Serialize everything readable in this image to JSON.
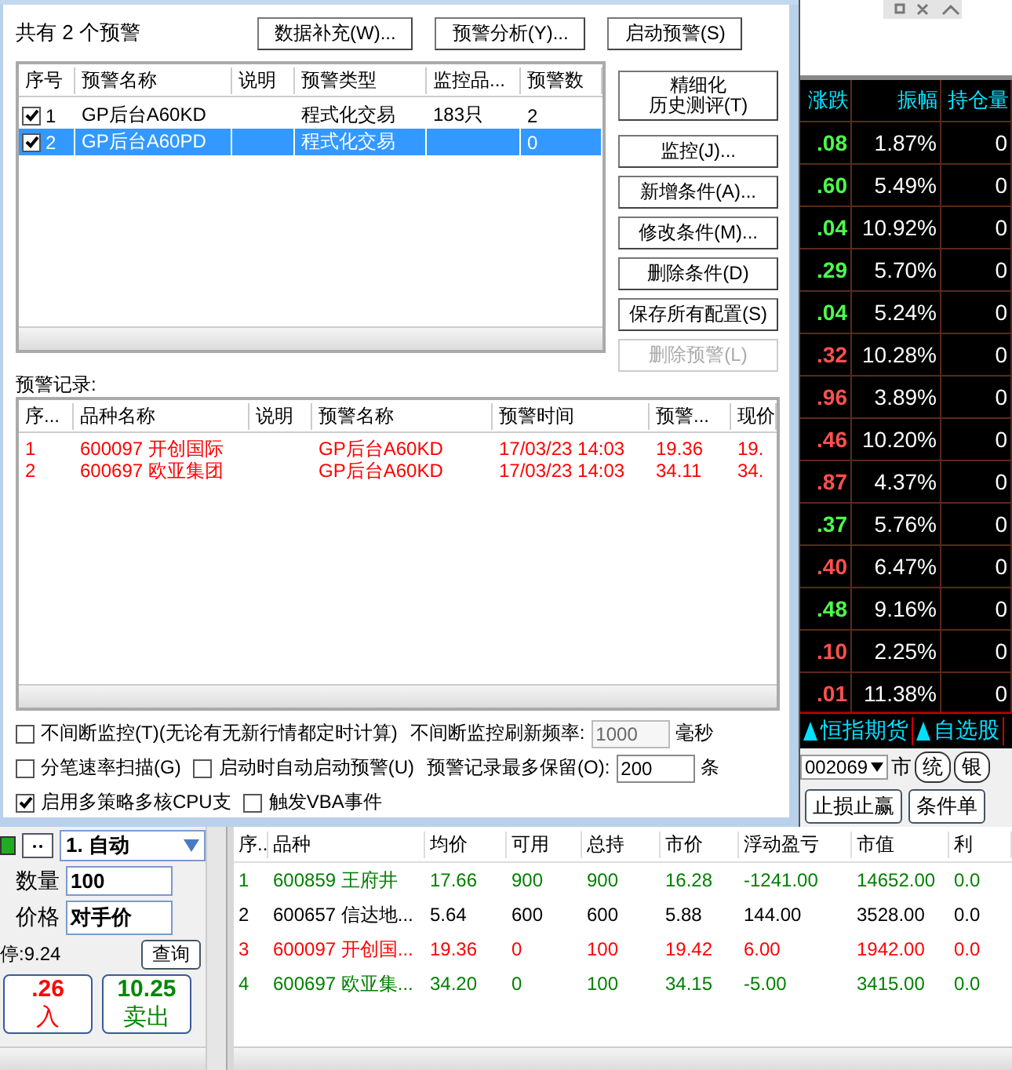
{
  "quote_table": {
    "columns": [
      "涨跌",
      "振幅",
      "持仓量"
    ],
    "rows": [
      {
        "change": ".08",
        "color": "#4cff4c",
        "amplitude": "1.87%",
        "open_interest": "0"
      },
      {
        "change": ".60",
        "color": "#4cff4c",
        "amplitude": "5.49%",
        "open_interest": "0"
      },
      {
        "change": ".04",
        "color": "#4cff4c",
        "amplitude": "10.92%",
        "open_interest": "0"
      },
      {
        "change": ".29",
        "color": "#4cff4c",
        "amplitude": "5.70%",
        "open_interest": "0"
      },
      {
        "change": ".04",
        "color": "#4cff4c",
        "amplitude": "5.24%",
        "open_interest": "0"
      },
      {
        "change": ".32",
        "color": "#ff5050",
        "amplitude": "10.28%",
        "open_interest": "0"
      },
      {
        "change": ".96",
        "color": "#ff5050",
        "amplitude": "3.89%",
        "open_interest": "0"
      },
      {
        "change": ".46",
        "color": "#ff5050",
        "amplitude": "10.20%",
        "open_interest": "0"
      },
      {
        "change": ".87",
        "color": "#ff5050",
        "amplitude": "4.37%",
        "open_interest": "0"
      },
      {
        "change": ".37",
        "color": "#4cff4c",
        "amplitude": "5.76%",
        "open_interest": "0"
      },
      {
        "change": ".40",
        "color": "#ff5050",
        "amplitude": "6.47%",
        "open_interest": "0"
      },
      {
        "change": ".48",
        "color": "#4cff4c",
        "amplitude": "9.16%",
        "open_interest": "0"
      },
      {
        "change": ".10",
        "color": "#ff5050",
        "amplitude": "2.25%",
        "open_interest": "0"
      },
      {
        "change": ".01",
        "color": "#ff5050",
        "amplitude": "11.38%",
        "open_interest": "0"
      }
    ]
  },
  "quote_tabs": [
    {
      "label": "恒指期货"
    },
    {
      "label": "自选股"
    }
  ],
  "code_dropdown": {
    "value": "002069"
  },
  "market_label": "市",
  "market_buttons": [
    "统",
    "银"
  ],
  "order_buttons": [
    "止损止赢",
    "条件单"
  ],
  "order_panel": {
    "mode": "1. 自动",
    "quantity_label": "数量",
    "quantity": "100",
    "price_label": "价格",
    "price": "对手价",
    "limit_text": "停:9.24",
    "query_button": "查询",
    "buy_price": ".26",
    "buy_label": "入",
    "sell_price": "10.25",
    "sell_label": "卖出"
  },
  "positions": {
    "columns": [
      "序..",
      "品种",
      "均价",
      "可用",
      "总持",
      "市价",
      "浮动盈亏",
      "市值",
      "利"
    ],
    "rows": [
      {
        "color": "#008000",
        "cells": [
          "1",
          "600859 王府井",
          "17.66",
          "900",
          "900",
          "16.28",
          "-1241.00",
          "14652.00",
          "0.0"
        ]
      },
      {
        "color": "#000000",
        "cells": [
          "2",
          "600657 信达地...",
          "5.64",
          "600",
          "600",
          "5.88",
          "144.00",
          "3528.00",
          "0.0"
        ]
      },
      {
        "color": "#ff0000",
        "cells": [
          "3",
          "600097 开创国...",
          "19.36",
          "0",
          "100",
          "19.42",
          "6.00",
          "1942.00",
          "0.0"
        ]
      },
      {
        "color": "#008000",
        "cells": [
          "4",
          "600697 欧亚集...",
          "34.20",
          "0",
          "100",
          "34.15",
          "-5.00",
          "3415.00",
          "0.0"
        ]
      }
    ]
  },
  "dialog": {
    "summary": "共有 2 个预警",
    "top_buttons": [
      {
        "label": "数据补充(W)...",
        "disabled": false
      },
      {
        "label": "预警分析(Y)...",
        "disabled": false
      },
      {
        "label": "启动预警(S)",
        "disabled": false
      }
    ],
    "strategy_list": {
      "columns": [
        "序号",
        "预警名称",
        "说明",
        "预警类型",
        "监控品...",
        "预警数"
      ],
      "rows": [
        {
          "checked": true,
          "selected": false,
          "index": "1",
          "name": "GP后台A60KD",
          "type": "程式化交易",
          "monitored": "183只",
          "count": "2"
        },
        {
          "checked": true,
          "selected": true,
          "index": "2",
          "name": "GP后台A60PD",
          "type": "程式化交易",
          "count": "0"
        }
      ]
    },
    "side_buttons": [
      {
        "label": "精细化",
        "subtitle": "历史测评(T)",
        "disabled": false
      },
      {
        "label": "监控(J)...",
        "disabled": false
      },
      {
        "label": "新增条件(A)...",
        "disabled": false
      },
      {
        "label": "修改条件(M)...",
        "disabled": false
      },
      {
        "label": "删除条件(D)",
        "disabled": false
      },
      {
        "label": "保存所有配置(S)",
        "disabled": false
      },
      {
        "label": "删除预警(L)",
        "disabled": true
      }
    ],
    "records_label": "预警记录:",
    "records": {
      "columns": [
        "序...",
        "品种名称",
        "说明",
        "预警名称",
        "预警时间",
        "预警...",
        "现价"
      ],
      "rows": [
        {
          "cells": [
            "1",
            "600097 开创国际",
            "",
            "GP后台A60KD",
            "17/03/23 14:03",
            "19.36",
            "19."
          ]
        },
        {
          "cells": [
            "2",
            "600697 欧亚集团",
            "",
            "GP后台A60KD",
            "17/03/23 14:03",
            "34.11",
            "34."
          ]
        }
      ]
    },
    "options": [
      [
        {
          "kind": "checkbox",
          "label": "不间断监控(T)(无论有无新行情都定时计算)",
          "checked": false
        },
        {
          "kind": "field",
          "label": "不间断监控刷新频率:",
          "value": "1000",
          "unit": "毫秒",
          "disabled": true
        }
      ],
      [
        {
          "kind": "checkbox",
          "label": "分笔速率扫描(G)",
          "checked": false
        },
        {
          "kind": "checkbox",
          "label": "启动时自动启动预警(U)",
          "checked": false
        },
        {
          "kind": "field",
          "label": "预警记录最多保留(O):",
          "value": "200",
          "unit": "条",
          "disabled": false
        }
      ],
      [
        {
          "kind": "checkbox",
          "label": "启用多策略多核CPU支",
          "checked": true
        },
        {
          "kind": "checkbox",
          "label": "触发VBA事件",
          "checked": false
        }
      ]
    ]
  }
}
